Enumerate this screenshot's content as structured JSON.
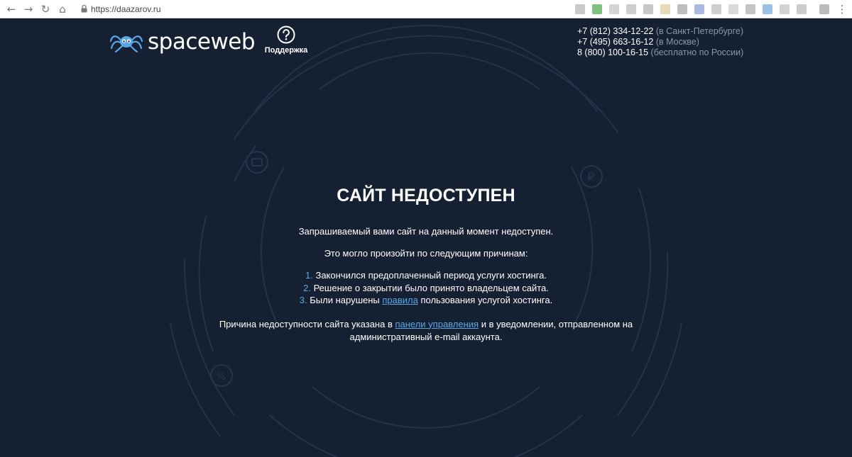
{
  "browser": {
    "url": "https://daazarov.ru",
    "back_icon": "arrow-left-icon",
    "forward_icon": "arrow-right-icon",
    "reload_icon": "reload-icon",
    "home_icon": "home-icon",
    "lock_icon": "lock-icon"
  },
  "header": {
    "logo_text": "spaceweb",
    "support_label": "Поддержка",
    "phones": [
      {
        "number": "+7 (812) 334-12-22",
        "note": " (в Санкт-Петербурге)"
      },
      {
        "number": "+7 (495) 663-16-12",
        "note": " (в Москве)"
      },
      {
        "number": "8 (800) 100-16-15",
        "note": " (бесплатно по России)"
      }
    ]
  },
  "main": {
    "title": "САЙТ НЕДОСТУПЕН",
    "intro": "Запрашиваемый вами сайт на данный момент недоступен.",
    "reasons_heading": "Это могло произойти по следующим причинам:",
    "reasons": [
      {
        "num": "1.",
        "text": "Закончился предоплаченный период услуги хостинга."
      },
      {
        "num": "2.",
        "text": "Решение о закрытии было принято владельцем сайта."
      },
      {
        "num": "3.",
        "text_before": "Были нарушены ",
        "link": "правила",
        "text_after": " пользования услугой хостинга."
      }
    ],
    "footer_before": "Причина недоступности сайта указана в ",
    "footer_link": "панели управления",
    "footer_after": " и в уведомлении, отправленном на административный e-mail аккаунта."
  },
  "colors": {
    "background": "#152132",
    "accent": "#5aa7e6",
    "muted": "#8b97a8"
  }
}
